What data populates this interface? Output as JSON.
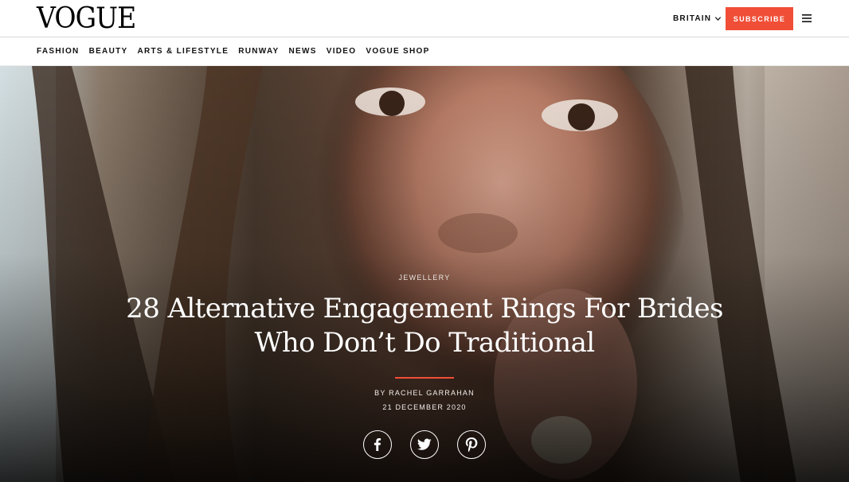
{
  "header": {
    "logo": "VOGUE",
    "region": "BRITAIN",
    "region_icon": "chevron-down-icon",
    "subscribe_label": "SUBSCRIBE",
    "menu_icon": "hamburger-menu-icon"
  },
  "nav": {
    "items": [
      "FASHION",
      "BEAUTY",
      "ARTS & LIFESTYLE",
      "RUNWAY",
      "NEWS",
      "VIDEO",
      "VOGUE SHOP"
    ]
  },
  "article": {
    "rubric": "JEWELLERY",
    "headline": "28 Alternative Engagement Rings For Brides Who Don’t Do Traditional",
    "byline_prefix": "BY",
    "author": "RACHEL GARRAHAN",
    "date": "21 DECEMBER 2020"
  },
  "share": [
    {
      "network": "facebook",
      "icon": "facebook-icon"
    },
    {
      "network": "twitter",
      "icon": "twitter-icon"
    },
    {
      "network": "pinterest",
      "icon": "pinterest-icon"
    }
  ],
  "colors": {
    "accent": "#f04e37",
    "text": "#000000",
    "hero_text": "#ffffff"
  }
}
